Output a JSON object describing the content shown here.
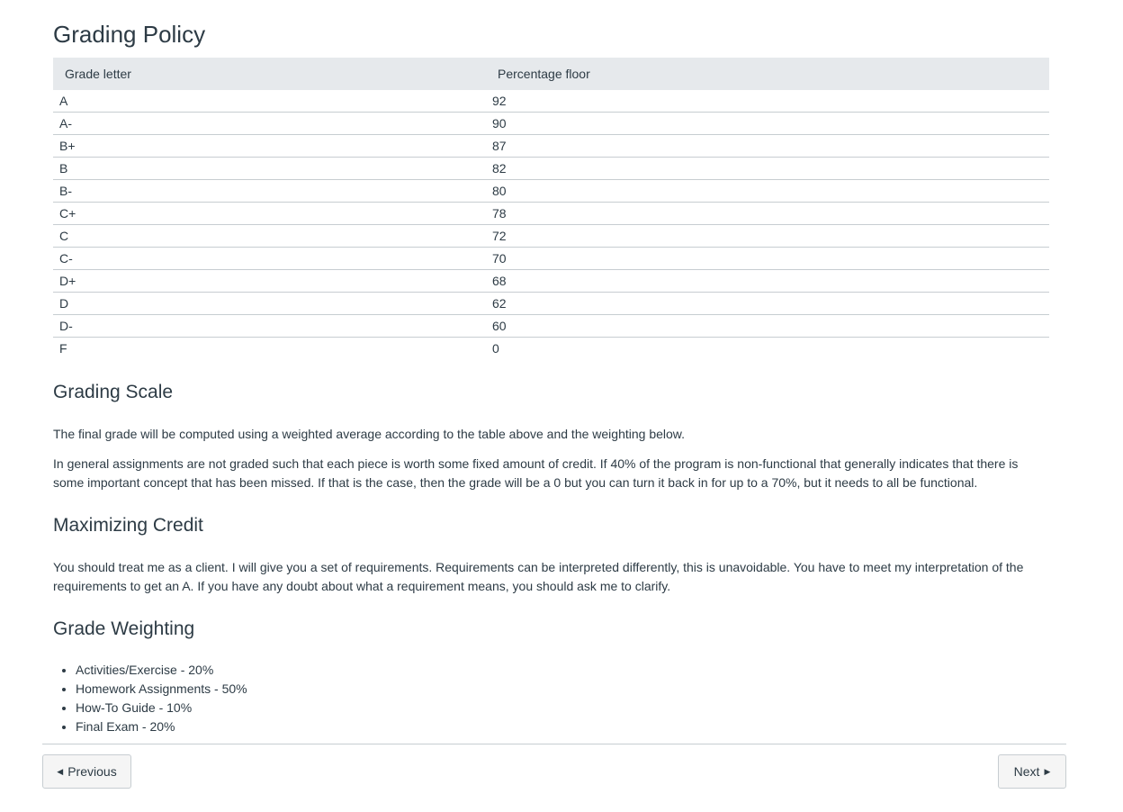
{
  "page": {
    "title": "Grading Policy"
  },
  "grade_table": {
    "headers": [
      "Grade letter",
      "Percentage floor"
    ],
    "rows": [
      {
        "letter": "A",
        "floor": "92"
      },
      {
        "letter": "A-",
        "floor": "90"
      },
      {
        "letter": "B+",
        "floor": "87"
      },
      {
        "letter": "B",
        "floor": "82"
      },
      {
        "letter": "B-",
        "floor": "80"
      },
      {
        "letter": "C+",
        "floor": "78"
      },
      {
        "letter": "C",
        "floor": "72"
      },
      {
        "letter": "C-",
        "floor": "70"
      },
      {
        "letter": "D+",
        "floor": "68"
      },
      {
        "letter": "D",
        "floor": "62"
      },
      {
        "letter": "D-",
        "floor": "60"
      },
      {
        "letter": "F",
        "floor": "0"
      }
    ]
  },
  "sections": {
    "grading_scale": {
      "heading": "Grading Scale",
      "paragraphs": [
        "The final grade will be computed using a weighted average according to the table above and the weighting below.",
        "In general assignments are not graded such that each piece is worth some fixed amount of credit. If 40% of the program is non-functional that generally indicates that there is some important concept that has been missed. If that is the case, then the grade will be a 0 but you can turn it back in for up to a 70%, but it needs to all be functional."
      ]
    },
    "maximizing_credit": {
      "heading": "Maximizing Credit",
      "paragraphs": [
        "You should treat me as a client. I will give you a set of requirements. Requirements can be interpreted differently, this is unavoidable. You have to meet my interpretation of the requirements to get an A. If you have any doubt about what a requirement means, you should ask me to clarify."
      ]
    },
    "grade_weighting": {
      "heading": "Grade Weighting",
      "items": [
        "Activities/Exercise - 20%",
        "Homework Assignments - 50%",
        "How-To Guide - 10%",
        "Final Exam - 20%"
      ]
    }
  },
  "navigation": {
    "previous_label": "Previous",
    "next_label": "Next",
    "previous_icon": "triangle-left-icon",
    "next_icon": "triangle-right-icon"
  },
  "colors": {
    "text": "#2d3b45",
    "table_header_bg": "#e6e9ec",
    "border": "#c7cdd1",
    "button_bg": "#f5f5f5"
  }
}
